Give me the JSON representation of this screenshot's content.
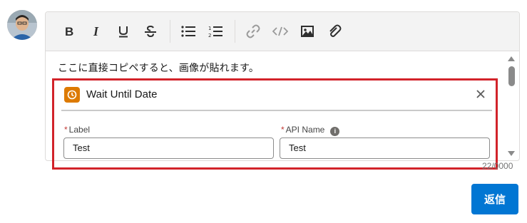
{
  "toolbar": {
    "buttons": [
      "bold-icon",
      "italic-icon",
      "underline-icon",
      "strikethrough-icon",
      "bulleted-list-icon",
      "numbered-list-icon",
      "link-icon",
      "code-icon",
      "image-icon",
      "attachment-icon"
    ]
  },
  "editor": {
    "content_text": "ここに直接コピペすると、画像が貼れます。",
    "counter": "22/0000"
  },
  "pasted_card": {
    "title": "Wait Until Date",
    "label_field": {
      "label": "Label",
      "value": "Test",
      "required": true
    },
    "api_name_field": {
      "label": "API Name",
      "value": "Test",
      "required": true
    }
  },
  "reply_button": {
    "label": "返信"
  },
  "colors": {
    "accent": "#0176d3",
    "highlight_border": "#d2232a",
    "card_icon": "#dd7a01"
  }
}
